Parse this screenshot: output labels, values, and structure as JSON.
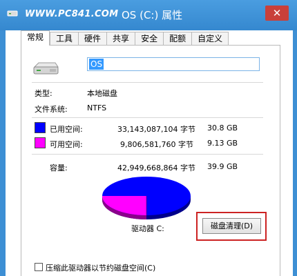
{
  "window": {
    "watermark": "WWW.PC841.COM",
    "title": "OS (C:) 属性",
    "close_glyph": "✕"
  },
  "tabs": [
    {
      "label": "常规",
      "active": true
    },
    {
      "label": "工具",
      "active": false
    },
    {
      "label": "硬件",
      "active": false
    },
    {
      "label": "共享",
      "active": false
    },
    {
      "label": "安全",
      "active": false
    },
    {
      "label": "配额",
      "active": false
    },
    {
      "label": "自定义",
      "active": false
    }
  ],
  "drive": {
    "icon": "drive-icon",
    "name": "OS"
  },
  "info": {
    "type_label": "类型:",
    "type_value": "本地磁盘",
    "fs_label": "文件系统:",
    "fs_value": "NTFS"
  },
  "space": {
    "used": {
      "label": "已用空间:",
      "bytes": "33,143,087,104 字节",
      "size": "30.8 GB",
      "color": "#0000ff"
    },
    "free": {
      "label": "可用空间:",
      "bytes": "9,806,581,760 字节",
      "size": "9.13 GB",
      "color": "#ff00ff"
    },
    "capacity": {
      "label": "容量:",
      "bytes": "42,949,668,864 字节",
      "size": "39.9 GB"
    }
  },
  "drive_label": "驱动器 C:",
  "cleanup_button": "磁盘清理(D)",
  "compress_checkbox": "压缩此驱动器以节约磁盘空间(C)"
}
